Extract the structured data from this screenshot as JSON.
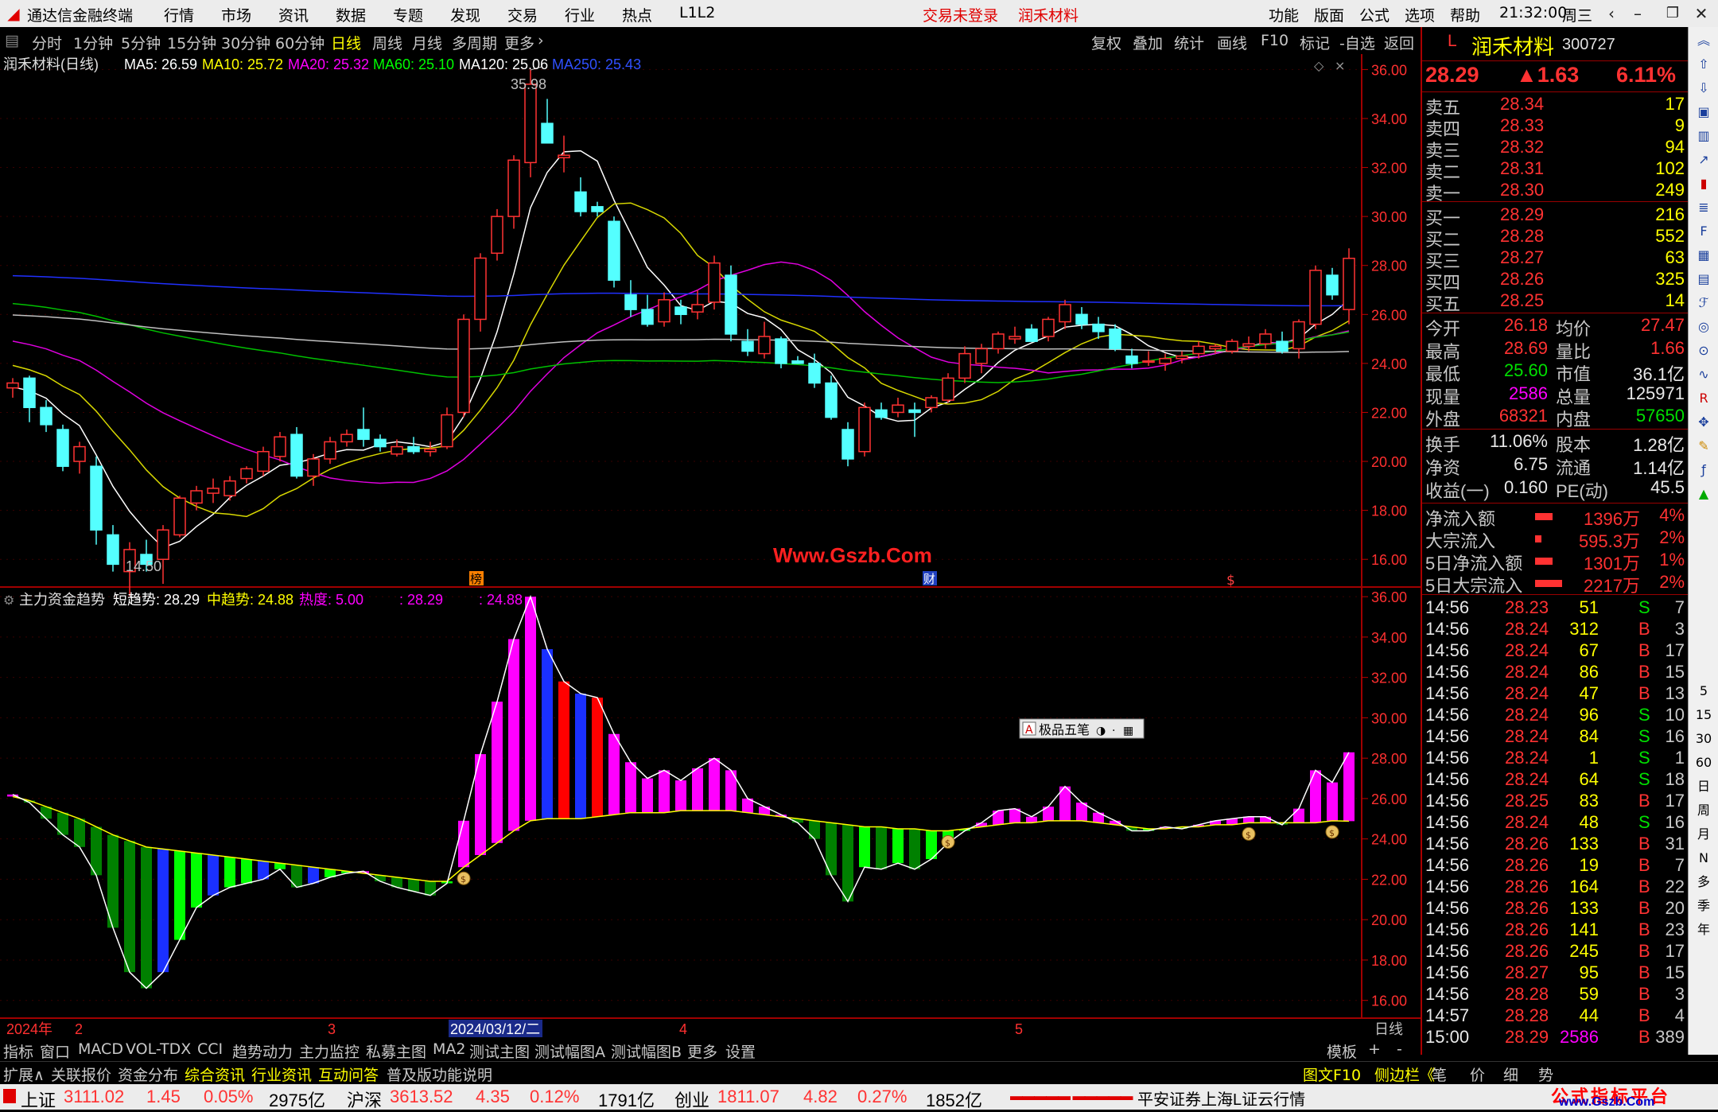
{
  "menubar": {
    "app_title": "通达信金融终端",
    "menus": [
      "行情",
      "市场",
      "资讯",
      "数据",
      "专题",
      "发现",
      "交易",
      "行业",
      "热点",
      "L1L2"
    ],
    "login_status": "交易未登录",
    "stock_name": "润禾材料",
    "right_menus": [
      "功能",
      "版面",
      "公式",
      "选项",
      "帮助"
    ],
    "time": "21:32:00",
    "weekday": "周三"
  },
  "period_tabs": {
    "items": [
      "分时",
      "1分钟",
      "5分钟",
      "15分钟",
      "30分钟",
      "60分钟",
      "日线",
      "周线",
      "月线",
      "多周期",
      "更多"
    ],
    "active": "日线",
    "tools": [
      "复权",
      "叠加",
      "统计",
      "画线",
      "F10",
      "标记",
      "-自选",
      "返回"
    ]
  },
  "kline": {
    "title": "润禾材料(日线)",
    "ma_labels": [
      {
        "text": "MA5: 26.59",
        "color": "#ffffff"
      },
      {
        "text": "MA10: 25.72",
        "color": "#ffff00"
      },
      {
        "text": "MA20: 25.32",
        "color": "#ff00ff"
      },
      {
        "text": "MA60: 25.10",
        "color": "#00ff00"
      },
      {
        "text": "MA120: 25.06",
        "color": "#ffffff"
      },
      {
        "text": "MA250: 25.43",
        "color": "#3050ff"
      }
    ],
    "y_ticks": [
      "36.00",
      "34.00",
      "32.00",
      "30.00",
      "28.00",
      "26.00",
      "24.00",
      "22.00",
      "20.00",
      "18.00",
      "16.00"
    ],
    "high_label": "35.98",
    "low_label": "14.50",
    "watermark": "Www.Gszb.Com",
    "markers": [
      "榜",
      "财",
      "$"
    ]
  },
  "indicator": {
    "name": "主力资金趋势",
    "short_label": "短趋势: 28.29",
    "mid_label": "中趋势: 24.88",
    "heat_label": "热度: 5.00",
    "v1": ": 28.29",
    "v2": ": 24.88",
    "y_ticks": [
      "36.00",
      "34.00",
      "32.00",
      "30.00",
      "28.00",
      "26.00",
      "24.00",
      "22.00",
      "20.00",
      "18.00",
      "16.00"
    ],
    "popup_label": "极品五笔"
  },
  "date_axis": {
    "labels": [
      "2024年",
      "2",
      "3",
      "2024/03/12/二",
      "4",
      "5"
    ],
    "right_label": "日线"
  },
  "bottom_tabs": {
    "items": [
      "指标",
      "窗口",
      "MACD",
      "VOL-TDX",
      "CCI",
      "趋势动力",
      "主力监控",
      "私募主图",
      "MA2",
      "测试主图",
      "测试幅图A",
      "测试幅图B",
      "更多",
      "设置"
    ],
    "right": [
      "模板",
      "+",
      "-"
    ]
  },
  "bottom_tabs2": {
    "items": [
      "扩展∧",
      "关联报价",
      "资金分布",
      "综合资讯",
      "行业资讯",
      "互动问答",
      "普及版功能说明"
    ],
    "right": [
      "图文F10",
      "侧边栏《",
      "笔",
      "价",
      "细",
      "势"
    ]
  },
  "quote": {
    "name": "润禾材料",
    "code": "300727",
    "price": "28.29",
    "change": "▲1.63",
    "pct": "6.11%",
    "asks": [
      {
        "label": "卖五",
        "price": "28.34",
        "vol": "17"
      },
      {
        "label": "卖四",
        "price": "28.33",
        "vol": "9"
      },
      {
        "label": "卖三",
        "price": "28.32",
        "vol": "94"
      },
      {
        "label": "卖二",
        "price": "28.31",
        "vol": "102"
      },
      {
        "label": "卖一",
        "price": "28.30",
        "vol": "249"
      }
    ],
    "bids": [
      {
        "label": "买一",
        "price": "28.29",
        "vol": "216"
      },
      {
        "label": "买二",
        "price": "28.28",
        "vol": "552"
      },
      {
        "label": "买三",
        "price": "28.27",
        "vol": "63"
      },
      {
        "label": "买四",
        "price": "28.26",
        "vol": "325"
      },
      {
        "label": "买五",
        "price": "28.25",
        "vol": "14"
      }
    ],
    "stats1": [
      {
        "l1": "今开",
        "v1": "26.18",
        "c1": "red",
        "l2": "均价",
        "v2": "27.47",
        "c2": "red"
      },
      {
        "l1": "最高",
        "v1": "28.69",
        "c1": "red",
        "l2": "量比",
        "v2": "1.66",
        "c2": "red"
      },
      {
        "l1": "最低",
        "v1": "25.60",
        "c1": "grn",
        "l2": "市值",
        "v2": "36.1亿",
        "c2": "wht"
      },
      {
        "l1": "现量",
        "v1": "2586",
        "c1": "mag",
        "l2": "总量",
        "v2": "125971",
        "c2": "wht"
      },
      {
        "l1": "外盘",
        "v1": "68321",
        "c1": "red",
        "l2": "内盘",
        "v2": "57650",
        "c2": "grn"
      }
    ],
    "stats2": [
      {
        "l1": "换手",
        "v1": "11.06%",
        "l2": "股本",
        "v2": "1.28亿"
      },
      {
        "l1": "净资",
        "v1": "6.75",
        "l2": "流通",
        "v2": "1.14亿"
      },
      {
        "l1": "收益(一)",
        "v1": "0.160",
        "l2": "PE(动)",
        "v2": "45.5"
      }
    ],
    "flows": [
      {
        "label": "净流入额",
        "value": "1396万",
        "pct": "4%"
      },
      {
        "label": "大宗流入",
        "value": "595.3万",
        "pct": "2%"
      },
      {
        "label": "5日净流入额",
        "value": "1301万",
        "pct": "1%"
      },
      {
        "label": "5日大宗流入",
        "value": "2217万",
        "pct": "2%"
      }
    ],
    "ticks": [
      [
        "14:56",
        "28.23",
        "51",
        "S",
        "7"
      ],
      [
        "14:56",
        "28.24",
        "312",
        "B",
        "3"
      ],
      [
        "14:56",
        "28.24",
        "67",
        "B",
        "17"
      ],
      [
        "14:56",
        "28.24",
        "86",
        "B",
        "15"
      ],
      [
        "14:56",
        "28.24",
        "47",
        "B",
        "13"
      ],
      [
        "14:56",
        "28.24",
        "96",
        "S",
        "10"
      ],
      [
        "14:56",
        "28.24",
        "84",
        "S",
        "16"
      ],
      [
        "14:56",
        "28.24",
        "1",
        "S",
        "1"
      ],
      [
        "14:56",
        "28.24",
        "64",
        "S",
        "18"
      ],
      [
        "14:56",
        "28.25",
        "83",
        "B",
        "17"
      ],
      [
        "14:56",
        "28.24",
        "48",
        "S",
        "16"
      ],
      [
        "14:56",
        "28.26",
        "133",
        "B",
        "31"
      ],
      [
        "14:56",
        "28.26",
        "19",
        "B",
        "7"
      ],
      [
        "14:56",
        "28.26",
        "164",
        "B",
        "22"
      ],
      [
        "14:56",
        "28.26",
        "133",
        "B",
        "20"
      ],
      [
        "14:56",
        "28.26",
        "141",
        "B",
        "23"
      ],
      [
        "14:56",
        "28.26",
        "245",
        "B",
        "17"
      ],
      [
        "14:56",
        "28.27",
        "95",
        "B",
        "15"
      ],
      [
        "14:56",
        "28.28",
        "59",
        "B",
        "3"
      ],
      [
        "14:57",
        "28.28",
        "44",
        "B",
        "4"
      ],
      [
        "15:00",
        "28.29",
        "2586",
        "B",
        "389"
      ]
    ]
  },
  "sidebar_labels": [
    "5",
    "15",
    "30",
    "60",
    "日",
    "周",
    "月",
    "N",
    "多",
    "季",
    "年"
  ],
  "statusbar": {
    "items": [
      {
        "name": "上证",
        "value": "3111.02",
        "chg": "1.45",
        "pct": "0.05%",
        "amt": "2975亿"
      },
      {
        "name": "沪深",
        "value": "3613.52",
        "chg": "4.35",
        "pct": "0.12%",
        "amt": "1791亿"
      },
      {
        "name": "创业",
        "value": "1811.07",
        "chg": "4.82",
        "pct": "0.27%",
        "amt": "1852亿"
      }
    ],
    "source": "平安证券上海L证云行情",
    "brand": "公式指标平台",
    "brand_url": "www.Gszb.Com"
  },
  "chart_data": [
    {
      "type": "candlestick",
      "title": "润禾材料(日线)",
      "ylim": [
        15.0,
        36.5
      ],
      "ohlc": [
        [
          23.0,
          23.4,
          22.6,
          23.2
        ],
        [
          23.4,
          23.5,
          21.6,
          22.2
        ],
        [
          22.2,
          22.5,
          21.2,
          21.5
        ],
        [
          21.3,
          21.5,
          19.6,
          19.8
        ],
        [
          20.0,
          20.8,
          19.5,
          20.6
        ],
        [
          19.8,
          20.2,
          16.6,
          17.2
        ],
        [
          17.0,
          17.4,
          15.5,
          15.8
        ],
        [
          15.5,
          16.7,
          14.5,
          16.4
        ],
        [
          16.2,
          16.8,
          15.5,
          15.8
        ],
        [
          16.0,
          17.4,
          15.0,
          17.2
        ],
        [
          17.0,
          18.6,
          16.9,
          18.5
        ],
        [
          18.3,
          19.0,
          18.0,
          18.8
        ],
        [
          18.7,
          19.3,
          18.3,
          18.9
        ],
        [
          18.6,
          19.4,
          18.4,
          19.2
        ],
        [
          19.3,
          19.8,
          19.1,
          19.7
        ],
        [
          19.6,
          20.6,
          19.4,
          20.4
        ],
        [
          20.2,
          21.2,
          20.0,
          21.0
        ],
        [
          21.1,
          21.4,
          19.3,
          19.4
        ],
        [
          19.4,
          20.3,
          19.0,
          20.1
        ],
        [
          20.1,
          21.0,
          19.9,
          20.8
        ],
        [
          20.8,
          21.3,
          20.6,
          21.1
        ],
        [
          21.3,
          22.2,
          20.6,
          20.9
        ],
        [
          20.9,
          21.1,
          20.4,
          20.6
        ],
        [
          20.3,
          20.9,
          20.2,
          20.6
        ],
        [
          20.6,
          21.0,
          20.3,
          20.4
        ],
        [
          20.4,
          20.8,
          20.2,
          20.5
        ],
        [
          20.6,
          22.2,
          20.5,
          21.9
        ],
        [
          22.0,
          26.0,
          21.8,
          25.8
        ],
        [
          25.8,
          28.5,
          25.3,
          28.3
        ],
        [
          28.5,
          30.3,
          28.2,
          30.0
        ],
        [
          30.0,
          32.5,
          29.5,
          32.3
        ],
        [
          32.2,
          36.0,
          31.6,
          35.4
        ],
        [
          33.8,
          34.8,
          33.0,
          33.0
        ],
        [
          32.4,
          33.3,
          31.8,
          32.5
        ],
        [
          31.0,
          31.6,
          30.0,
          30.2
        ],
        [
          30.4,
          30.6,
          30.0,
          30.2
        ],
        [
          29.8,
          30.0,
          27.1,
          27.4
        ],
        [
          26.8,
          27.4,
          25.9,
          26.2
        ],
        [
          26.2,
          26.8,
          25.5,
          25.6
        ],
        [
          25.7,
          26.9,
          25.5,
          26.6
        ],
        [
          26.3,
          26.6,
          25.6,
          26.0
        ],
        [
          26.1,
          27.0,
          25.8,
          26.4
        ],
        [
          26.5,
          28.4,
          26.2,
          28.1
        ],
        [
          27.6,
          28.0,
          24.9,
          25.2
        ],
        [
          24.9,
          25.4,
          24.3,
          24.5
        ],
        [
          24.4,
          25.7,
          24.2,
          25.1
        ],
        [
          25.0,
          25.1,
          23.8,
          24.0
        ],
        [
          24.1,
          24.3,
          24.0,
          24.0
        ],
        [
          24.0,
          24.4,
          23.0,
          23.2
        ],
        [
          23.2,
          23.5,
          21.7,
          21.8
        ],
        [
          21.3,
          21.6,
          19.8,
          20.1
        ],
        [
          20.4,
          22.4,
          20.2,
          22.2
        ],
        [
          22.1,
          22.4,
          21.7,
          21.8
        ],
        [
          22.0,
          22.6,
          21.8,
          22.3
        ],
        [
          22.1,
          22.4,
          21.0,
          22.0
        ],
        [
          22.2,
          22.7,
          22.0,
          22.6
        ],
        [
          22.5,
          23.6,
          22.4,
          23.4
        ],
        [
          23.4,
          24.7,
          23.2,
          24.4
        ],
        [
          24.0,
          24.8,
          23.6,
          24.6
        ],
        [
          24.6,
          25.3,
          24.4,
          25.2
        ],
        [
          25.0,
          25.5,
          24.8,
          25.1
        ],
        [
          25.4,
          25.6,
          25.0,
          24.9
        ],
        [
          25.1,
          25.9,
          24.9,
          25.8
        ],
        [
          25.7,
          26.6,
          25.4,
          26.4
        ],
        [
          26.0,
          26.3,
          25.4,
          25.6
        ],
        [
          25.6,
          25.9,
          25.0,
          25.3
        ],
        [
          25.4,
          25.6,
          24.5,
          24.6
        ],
        [
          24.3,
          24.6,
          23.8,
          24.0
        ],
        [
          24.1,
          24.5,
          23.9,
          24.1
        ],
        [
          24.0,
          24.4,
          23.7,
          24.2
        ],
        [
          24.2,
          24.5,
          24.0,
          24.3
        ],
        [
          24.4,
          24.9,
          24.2,
          24.7
        ],
        [
          24.6,
          24.8,
          24.4,
          24.7
        ],
        [
          24.5,
          25.0,
          24.4,
          24.9
        ],
        [
          24.7,
          25.1,
          24.5,
          24.8
        ],
        [
          24.8,
          25.4,
          24.6,
          25.2
        ],
        [
          24.9,
          25.3,
          24.4,
          24.5
        ],
        [
          24.6,
          25.8,
          24.2,
          25.7
        ],
        [
          25.6,
          28.0,
          25.4,
          27.8
        ],
        [
          27.6,
          27.9,
          26.6,
          26.8
        ],
        [
          26.2,
          28.7,
          25.6,
          28.29
        ]
      ]
    },
    {
      "type": "bar",
      "title": "主力资金趋势",
      "series": [
        {
          "name": "短趋势",
          "values": [
            26.2,
            25.8,
            25.0,
            24.2,
            23.6,
            22.2,
            19.6,
            17.4,
            16.6,
            17.4,
            19.0,
            20.6,
            21.2,
            21.6,
            21.8,
            22.0,
            22.5,
            21.6,
            21.8,
            22.1,
            22.3,
            22.4,
            21.9,
            21.6,
            21.4,
            21.2,
            21.8,
            24.9,
            28.2,
            30.8,
            33.9,
            36.0,
            33.4,
            31.8,
            31.2,
            31.0,
            29.2,
            27.8,
            27.0,
            27.4,
            26.9,
            27.5,
            28.0,
            27.4,
            26.0,
            25.6,
            25.2,
            24.8,
            24.0,
            22.2,
            20.9,
            22.6,
            22.5,
            22.8,
            22.5,
            23.0,
            23.8,
            24.4,
            24.8,
            25.4,
            25.5,
            25.1,
            25.6,
            26.6,
            25.8,
            25.3,
            24.9,
            24.4,
            24.4,
            24.6,
            24.5,
            24.7,
            24.9,
            25.0,
            25.1,
            25.1,
            24.7,
            25.5,
            27.4,
            26.8,
            28.29
          ]
        },
        {
          "name": "中趋势",
          "values": [
            26.1,
            25.9,
            25.6,
            25.3,
            25.0,
            24.6,
            24.2,
            23.9,
            23.6,
            23.5,
            23.4,
            23.3,
            23.2,
            23.1,
            23.0,
            22.9,
            22.8,
            22.7,
            22.6,
            22.5,
            22.4,
            22.3,
            22.2,
            22.1,
            22.0,
            21.9,
            21.9,
            22.6,
            23.2,
            23.8,
            24.4,
            24.9,
            25.0,
            25.0,
            25.0,
            25.1,
            25.2,
            25.3,
            25.3,
            25.3,
            25.4,
            25.4,
            25.4,
            25.4,
            25.3,
            25.2,
            25.1,
            25.0,
            24.9,
            24.8,
            24.7,
            24.6,
            24.6,
            24.5,
            24.5,
            24.4,
            24.4,
            24.5,
            24.6,
            24.7,
            24.8,
            24.8,
            24.9,
            24.9,
            24.9,
            24.8,
            24.7,
            24.6,
            24.5,
            24.5,
            24.6,
            24.6,
            24.7,
            24.7,
            24.8,
            24.8,
            24.8,
            24.8,
            24.8,
            24.9,
            24.88
          ]
        }
      ]
    }
  ]
}
